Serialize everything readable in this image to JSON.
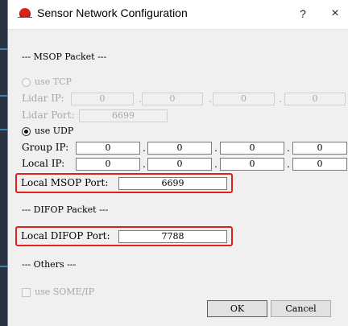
{
  "window": {
    "title": "Sensor Network Configuration",
    "help_label": "?",
    "close_label": "×"
  },
  "msop": {
    "header": "--- MSOP Packet ---",
    "use_tcp_label": "use TCP",
    "lidar_ip_label": "Lidar IP:",
    "lidar_ip": [
      "0",
      "0",
      "0",
      "0"
    ],
    "lidar_port_label": "Lidar Port:",
    "lidar_port": "6699",
    "use_udp_label": "use UDP",
    "group_ip_label": "Group IP:",
    "group_ip": [
      "0",
      "0",
      "0",
      "0"
    ],
    "local_ip_label": "Local  IP:",
    "local_ip": [
      "0",
      "0",
      "0",
      "0"
    ],
    "local_port_label": "Local MSOP  Port:",
    "local_port": "6699"
  },
  "difop": {
    "header": "--- DIFOP Packet ---",
    "local_port_label": "Local DIFOP Port:",
    "local_port": "7788"
  },
  "others": {
    "header": "--- Others ---",
    "someip_label": "use SOME/IP"
  },
  "buttons": {
    "ok": "OK",
    "cancel": "Cancel"
  },
  "dot": ".",
  "colors": {
    "highlight": "#e0201a",
    "brand": "#d6261b"
  }
}
